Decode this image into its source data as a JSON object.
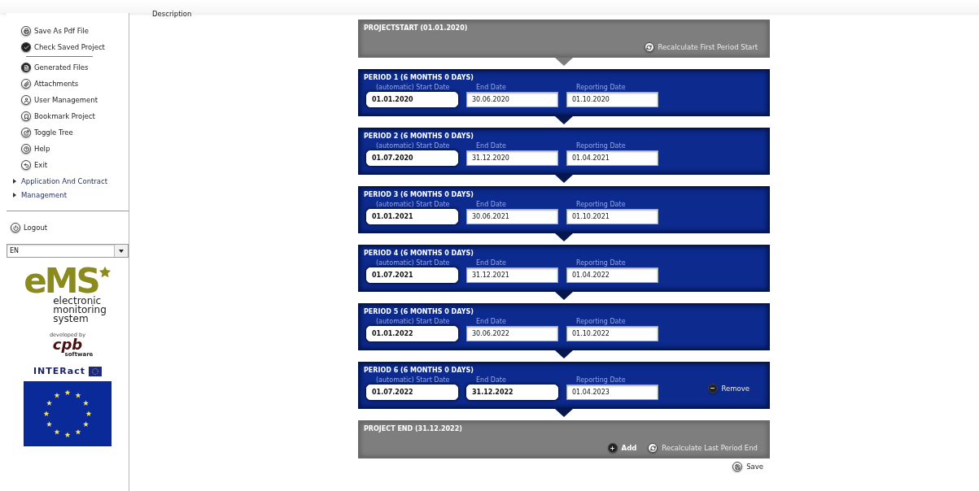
{
  "sidebar": {
    "actions": [
      {
        "kind": "print",
        "label": "Save As Pdf File"
      },
      {
        "kind": "check",
        "label": "Check Saved Project"
      }
    ],
    "menu": [
      {
        "kind": "files",
        "label": "Generated Files"
      },
      {
        "kind": "attach",
        "label": "Attachments"
      },
      {
        "kind": "user",
        "label": "User Management"
      },
      {
        "kind": "bookmark",
        "label": "Bookmark Project"
      },
      {
        "kind": "tree",
        "label": "Toggle Tree"
      },
      {
        "kind": "help",
        "label": "Help"
      },
      {
        "kind": "exit",
        "label": "Exit"
      }
    ],
    "tree": [
      {
        "label": "Application And Contract",
        "expanded": false
      },
      {
        "label": "Management",
        "expanded": false
      }
    ],
    "logout": "Logout",
    "language": "EN",
    "logo": {
      "mark": "eMS",
      "lines": [
        "electronic",
        "monitoring",
        "system"
      ],
      "developed_by": "developed by",
      "vendor": "cpb",
      "vendor_sub": "software",
      "partner": "INTERact"
    }
  },
  "content": {
    "label": "Description",
    "project_start": {
      "title": "PROJECTSTART (01.01.2020)",
      "actions": [
        {
          "kind": "recalculate",
          "label": "Recalculate First Period Start",
          "disabled": true
        }
      ]
    },
    "periods": [
      {
        "title": "PERIOD 1 (6 MONTHS 0 DAYS)",
        "fields": [
          {
            "label": "(automatic) Start Date",
            "value": "01.01.2020",
            "readonly": true
          },
          {
            "label": "End Date",
            "value": "30.06.2020",
            "readonly": false
          },
          {
            "label": "Reporting Date",
            "value": "01.10.2020",
            "readonly": false
          }
        ]
      },
      {
        "title": "PERIOD 2 (6 MONTHS 0 DAYS)",
        "fields": [
          {
            "label": "(automatic) Start Date",
            "value": "01.07.2020",
            "readonly": true
          },
          {
            "label": "End Date",
            "value": "31.12.2020",
            "readonly": false
          },
          {
            "label": "Reporting Date",
            "value": "01.04.2021",
            "readonly": false
          }
        ]
      },
      {
        "title": "PERIOD 3 (6 MONTHS 0 DAYS)",
        "fields": [
          {
            "label": "(automatic) Start Date",
            "value": "01.01.2021",
            "readonly": true
          },
          {
            "label": "End Date",
            "value": "30.06.2021",
            "readonly": false
          },
          {
            "label": "Reporting Date",
            "value": "01.10.2021",
            "readonly": false
          }
        ]
      },
      {
        "title": "PERIOD 4 (6 MONTHS 0 DAYS)",
        "fields": [
          {
            "label": "(automatic) Start Date",
            "value": "01.07.2021",
            "readonly": true
          },
          {
            "label": "End Date",
            "value": "31.12.2021",
            "readonly": false
          },
          {
            "label": "Reporting Date",
            "value": "01.04.2022",
            "readonly": false
          }
        ]
      },
      {
        "title": "PERIOD 5 (6 MONTHS 0 DAYS)",
        "fields": [
          {
            "label": "(automatic) Start Date",
            "value": "01.01.2022",
            "readonly": true
          },
          {
            "label": "End Date",
            "value": "30.06.2022",
            "readonly": false
          },
          {
            "label": "Reporting Date",
            "value": "01.10.2022",
            "readonly": false
          }
        ]
      },
      {
        "title": "PERIOD 6 (6 MONTHS 0 DAYS)",
        "fields": [
          {
            "label": "(automatic) Start Date",
            "value": "01.07.2022",
            "readonly": true
          },
          {
            "label": "End Date",
            "value": "31.12.2022",
            "readonly": true
          },
          {
            "label": "Reporting Date",
            "value": "01.04.2023",
            "readonly": false
          }
        ],
        "remove": {
          "label": "Remove",
          "disabled": true
        }
      }
    ],
    "project_end": {
      "title": "PROJECT END (31.12.2022)",
      "actions": [
        {
          "kind": "add",
          "label": "Add",
          "disabled": false
        },
        {
          "kind": "recalculate",
          "label": "Recalculate Last Period End",
          "disabled": true
        }
      ]
    },
    "save": "Save"
  }
}
